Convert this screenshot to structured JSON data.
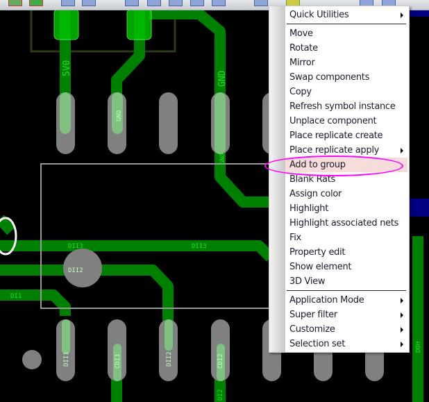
{
  "colors": {
    "trace": "#008000",
    "pad": "#808080",
    "highlight_ring": "#ff00ff",
    "menu_highlight": "#f7dcdc"
  },
  "pcb": {
    "nets": [
      "5V0",
      "GND",
      "GND",
      "GND",
      "DII3",
      "DII3",
      "DII2",
      "DI1",
      "DII1",
      "CDI1",
      "DII2",
      "CDI2",
      "DI2",
      "DOH"
    ]
  },
  "menu": {
    "items": [
      {
        "label": "Quick Utilities",
        "submenu": true
      },
      {
        "label": "Move"
      },
      {
        "label": "Rotate"
      },
      {
        "label": "Mirror"
      },
      {
        "label": "Swap components"
      },
      {
        "label": "Copy"
      },
      {
        "label": "Refresh symbol instance"
      },
      {
        "label": "Unplace component"
      },
      {
        "label": "Place replicate create"
      },
      {
        "label": "Place replicate apply",
        "submenu": true
      },
      {
        "label": "Add to group",
        "highlighted": true
      },
      {
        "label": "Blank Rats"
      },
      {
        "label": "Assign color"
      },
      {
        "label": "Highlight"
      },
      {
        "label": "Highlight associated nets"
      },
      {
        "label": "Fix"
      },
      {
        "label": "Property edit"
      },
      {
        "label": "Show element"
      },
      {
        "label": "3D View"
      },
      {
        "label": "Application Mode",
        "submenu": true
      },
      {
        "label": "Super filter",
        "submenu": true
      },
      {
        "label": "Customize",
        "submenu": true
      },
      {
        "label": "Selection set",
        "submenu": true
      }
    ]
  }
}
